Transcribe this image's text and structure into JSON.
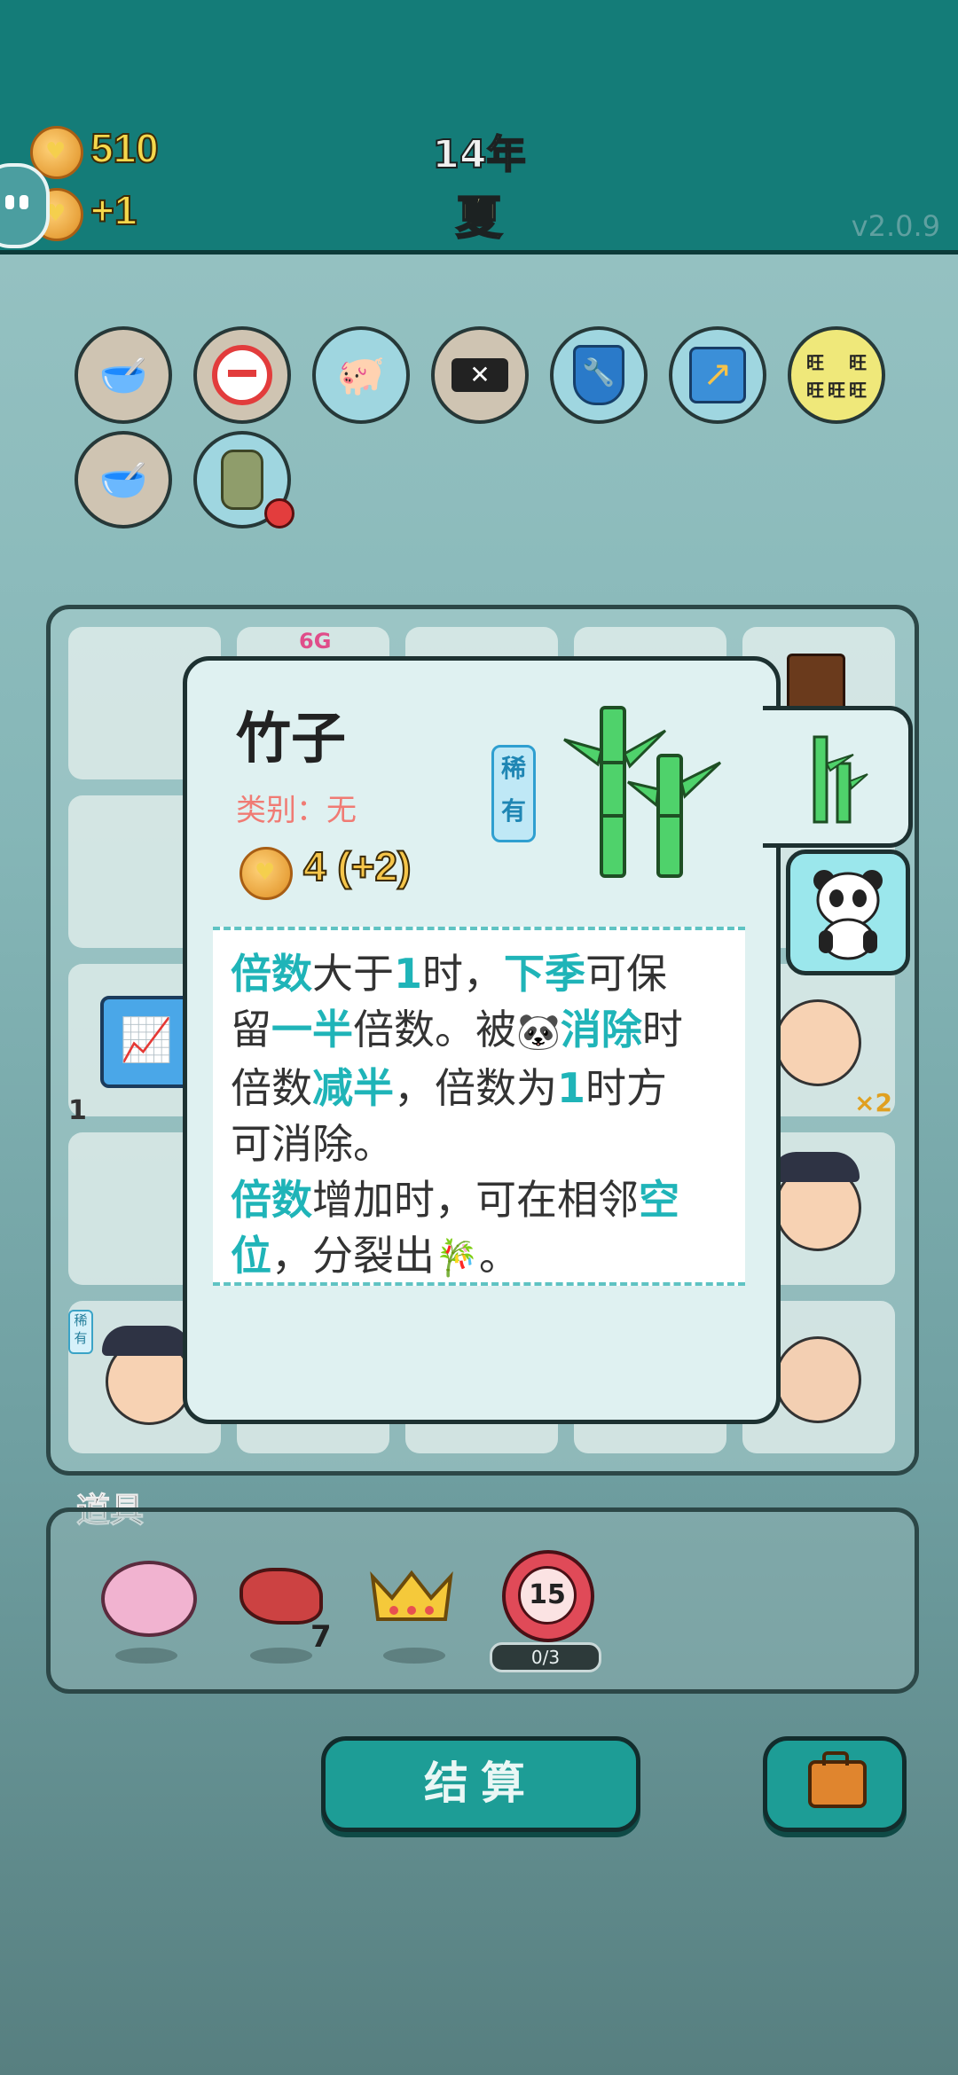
{
  "header": {
    "coins": "510",
    "income": "+1",
    "year": "14年",
    "season": "夏",
    "version": "v2.0.9"
  },
  "relics_row1": [
    "dog-bowl-icon",
    "minus-circle-icon",
    "piggy-bank-icon",
    "cancel-tag-icon",
    "shield-wrench-icon",
    "arrow-up-card-icon",
    "wang-text-icon"
  ],
  "relics_row2": [
    "dog-bowl-icon",
    "trash-bag-icon"
  ],
  "relic_wang_label": "旺",
  "board": {
    "rare_tag": "稀有",
    "cell_6g": "6G",
    "cell_count": "1",
    "cell_multiplier": "×2"
  },
  "detail": {
    "name": "竹子",
    "category": "类别：无",
    "price": "4 (+2)",
    "rarity": "稀有",
    "desc": [
      [
        {
          "t": "倍数",
          "h": true
        },
        {
          "t": "大于"
        },
        {
          "t": "1",
          "h": true
        },
        {
          "t": "时，"
        },
        {
          "t": "下季",
          "h": true
        },
        {
          "t": "可保"
        }
      ],
      [
        {
          "t": "留"
        },
        {
          "t": "一半",
          "h": true
        },
        {
          "t": "倍数。被"
        },
        {
          "icon": "panda"
        },
        {
          "t": "消除",
          "h": true
        },
        {
          "t": "时"
        }
      ],
      [
        {
          "t": "倍数"
        },
        {
          "t": "减半",
          "h": true
        },
        {
          "t": "，倍数为"
        },
        {
          "t": "1",
          "h": true
        },
        {
          "t": "时方"
        }
      ],
      [
        {
          "t": "可消除。"
        }
      ],
      [
        {
          "t": "倍数",
          "h": true
        },
        {
          "t": "增加时，可在相邻"
        },
        {
          "t": "空",
          "h": true
        }
      ],
      [
        {
          "t": "位",
          "h": true
        },
        {
          "t": "，分裂出"
        },
        {
          "icon": "bamboo"
        },
        {
          "t": "。"
        }
      ]
    ]
  },
  "props": {
    "label": "道具",
    "liver_count": "7",
    "timer_value": "15",
    "timer_progress": "0/3"
  },
  "settle_label": "结算",
  "colors": {
    "accent": "#1fb4b8",
    "topbar": "#147c78",
    "coin_text": "#f5d84c"
  }
}
